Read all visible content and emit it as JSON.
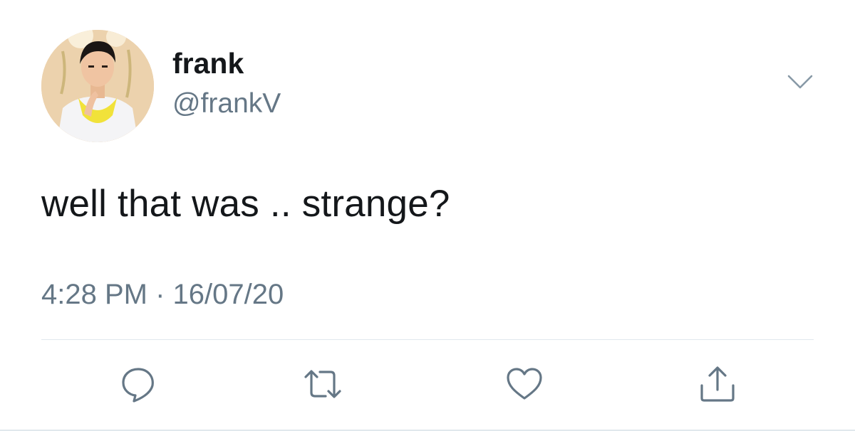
{
  "user": {
    "display_name": "frank",
    "handle": "@frankV"
  },
  "tweet": {
    "text": "well that was .. strange?",
    "time": "4:28 PM",
    "separator": "·",
    "date": "16/07/20"
  },
  "icons": {
    "menu": "chevron-down-icon",
    "reply": "reply-icon",
    "retweet": "retweet-icon",
    "like": "heart-icon",
    "share": "share-icon"
  },
  "colors": {
    "text": "#14171a",
    "secondary": "#657786",
    "divider": "#e1e8ed",
    "icon": "#657786"
  }
}
